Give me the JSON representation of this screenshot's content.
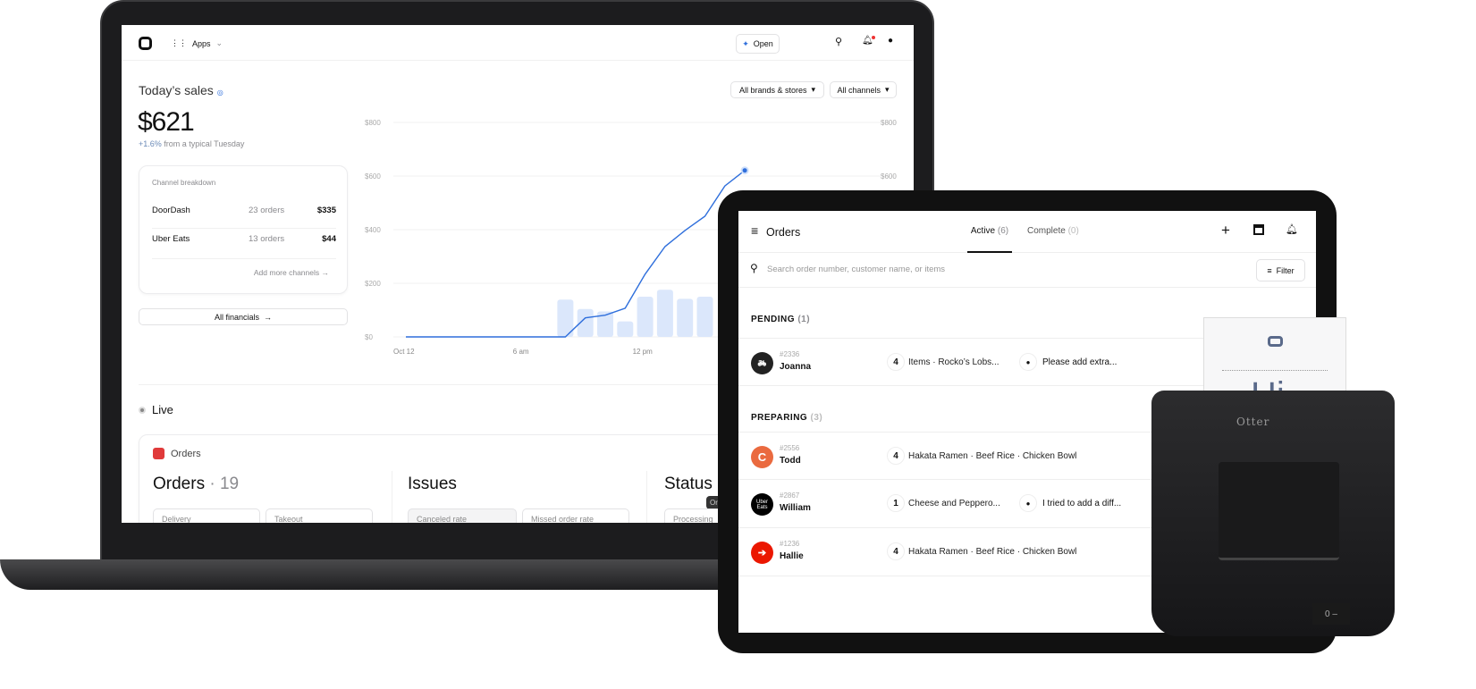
{
  "laptop": {
    "nav": {
      "apps_label": "Apps",
      "open_label": "Open"
    },
    "sales": {
      "title": "Today’s sales",
      "amount": "$621",
      "change": "+1.6%",
      "change_suffix": "from a typical Tuesday",
      "filters": [
        "All brands & stores",
        "All channels"
      ]
    },
    "channels": {
      "title": "Channel breakdown",
      "rows": [
        {
          "name": "DoorDash",
          "orders": "23 orders",
          "amount": "$335"
        },
        {
          "name": "Uber Eats",
          "orders": "13 orders",
          "amount": "$44"
        }
      ],
      "add_more": "Add more channels",
      "all_financials": "All financials"
    },
    "live": {
      "label": "Live",
      "app_label": "Orders",
      "orders_title": "Orders",
      "orders_count": "19",
      "issues_title": "Issues",
      "status_title": "Status",
      "tooltip": "Or",
      "metrics": [
        "Delivery",
        "Takeout",
        "Canceled rate",
        "Missed order rate",
        "Processing"
      ]
    }
  },
  "chart_data": {
    "type": "line",
    "x_tick_labels": [
      "Oct 12",
      "6 am",
      "12 pm"
    ],
    "y_tick_labels": [
      "$0",
      "$200",
      "$400",
      "$600",
      "$800"
    ],
    "right_y_tick_labels": [
      "$600",
      "$800"
    ],
    "ylim": [
      0,
      800
    ],
    "grid": true,
    "line_color": "#2f6fdc",
    "bar_color": "#dbe7fb",
    "series": [
      {
        "type": "line",
        "hours": [
          0,
          8,
          9,
          10,
          11,
          12,
          13,
          14,
          15,
          16,
          17
        ],
        "values": [
          0,
          0,
          71,
          81,
          107,
          234,
          337,
          397,
          450,
          563,
          621
        ]
      },
      {
        "type": "bar",
        "hours": [
          8,
          9,
          10,
          11,
          12,
          13,
          14,
          15
        ],
        "values": [
          139,
          104,
          95,
          58,
          150,
          176,
          142,
          150
        ]
      }
    ]
  },
  "tablet": {
    "title": "Orders",
    "tabs": [
      {
        "label": "Active",
        "count": "(6)"
      },
      {
        "label": "Complete",
        "count": "(0)"
      }
    ],
    "search_placeholder": "Search order number, customer name, or items",
    "filter_label": "Filter",
    "pending": {
      "label": "PENDING",
      "count": "(1)"
    },
    "preparing": {
      "label": "PREPARING",
      "count": "(3)"
    },
    "orders": [
      {
        "id": "#2336",
        "name": "Joanna",
        "qty": "4",
        "items": "Items · Rocko’s Lobs...",
        "note": "Please add extra...",
        "color": "#222"
      },
      {
        "id": "#2556",
        "name": "Todd",
        "qty": "4",
        "items": "Hakata Ramen · Beef Rice · Chicken Bowl",
        "note": "",
        "color": "#ea6a3f"
      },
      {
        "id": "#2867",
        "name": "William",
        "qty": "1",
        "items": "Cheese and Peppero...",
        "note": "I tried to add a diff...",
        "color": "#000",
        "logo": "Uber Eats"
      },
      {
        "id": "#1236",
        "name": "Hallie",
        "qty": "4",
        "items": "Hakata Ramen · Beef Rice · Chicken Bowl",
        "note": "",
        "color": "#eb1700"
      }
    ]
  },
  "printer": {
    "brand": "Otter",
    "receipt_text": "Hi",
    "switch_label": "0 –"
  }
}
